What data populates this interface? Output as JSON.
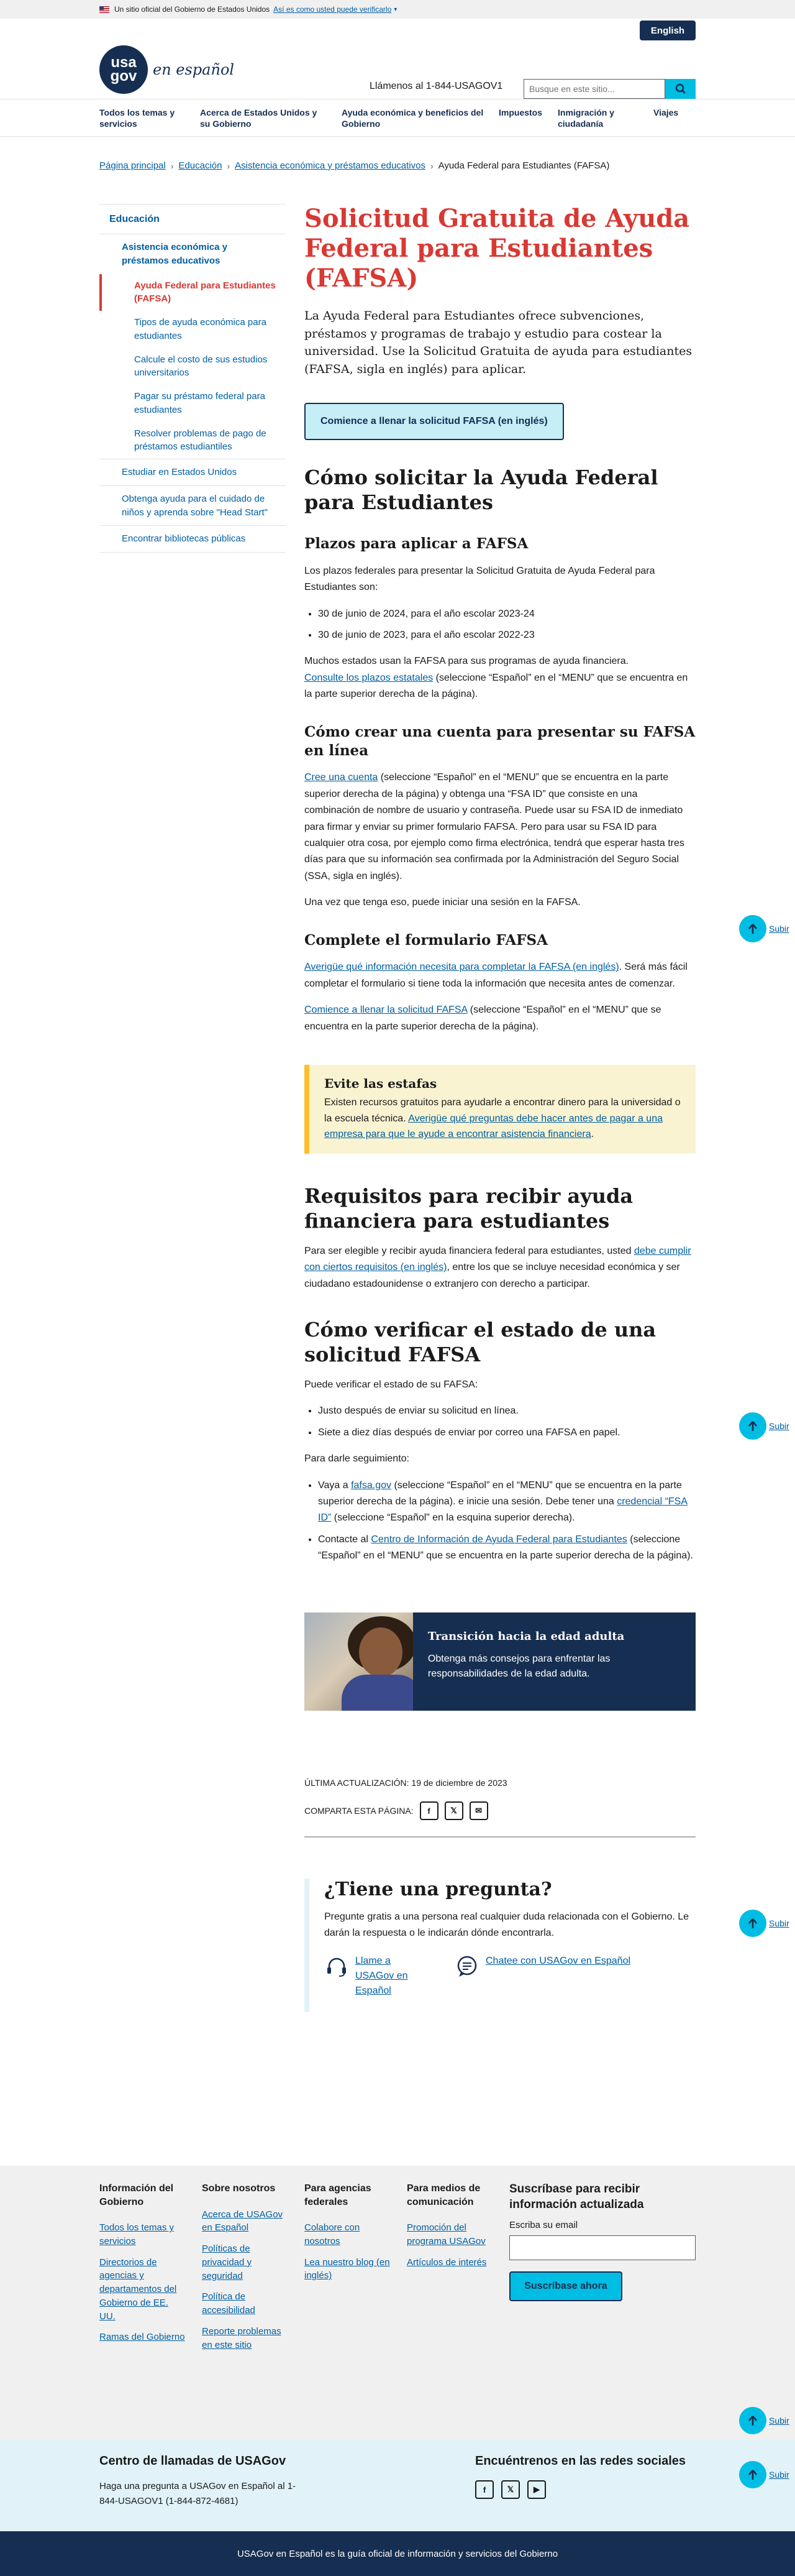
{
  "gov_banner": {
    "text": "Un sitio oficial del Gobierno de Estados Unidos",
    "how_to_verify": "Así es como usted puede verificarlo"
  },
  "header": {
    "language_button": "English",
    "logo_top": "usa",
    "logo_bottom": "gov",
    "logo_text": "en español",
    "phone": "Llámenos al 1-844-USAGOV1",
    "search_placeholder": "Busque en este sitio..."
  },
  "nav": {
    "items": [
      "Todos los temas y servicios",
      "Acerca de Estados Unidos y su Gobierno",
      "Ayuda económica y beneficios del Gobierno",
      "Impuestos",
      "Inmigración y ciudadanía",
      "Viajes"
    ]
  },
  "breadcrumb": {
    "items": [
      "Página principal",
      "Educación",
      "Asistencia económica y préstamos educativos"
    ],
    "current": "Ayuda Federal para Estudiantes (FAFSA)"
  },
  "sidebar": {
    "level1": "Educación",
    "level2": "Asistencia económica y préstamos educativos",
    "current": "Ayuda Federal para Estudiantes (FAFSA)",
    "subitems": [
      "Tipos de ayuda económica para estudiantes",
      "Calcule el costo de sus estudios universitarios",
      "Pagar su préstamo federal para estudiantes",
      "Resolver problemas de pago de préstamos estudiantiles"
    ],
    "other_items": [
      "Estudiar en Estados Unidos",
      "Obtenga ayuda para el cuidado de niños y aprenda sobre \"Head Start\"",
      "Encontrar bibliotecas públicas"
    ]
  },
  "main": {
    "title": "Solicitud Gratuita de Ayuda Federal para Estudiantes (FAFSA)",
    "intro": "La Ayuda Federal para Estudiantes ofrece subvenciones, préstamos y programas de trabajo y estudio para costear la universidad. Use la Solicitud Gratuita de ayuda para estudiantes (FAFSA, sigla en inglés) para aplicar.",
    "cta": "Comience a llenar la solicitud FAFSA (en inglés)",
    "how_to_apply": {
      "heading": "Cómo solicitar la Ayuda Federal para Estudiantes",
      "deadlines_heading": "Plazos para aplicar a FAFSA",
      "deadlines_intro": "Los plazos federales para presentar la Solicitud Gratuita de Ayuda Federal para Estudiantes son:",
      "deadlines": [
        "30 de junio de 2024, para el año escolar 2023-24",
        "30 de junio de 2023, para el año escolar 2022-23"
      ],
      "states_text": "Muchos estados usan la FAFSA para sus programas de ayuda financiera.",
      "states_link": "Consulte los plazos estatales",
      "states_suffix": " (seleccione “Español” en el “MENU” que se encuentra en la parte superior derecha de la página).",
      "account_heading": "Cómo crear una cuenta para presentar su FAFSA en línea",
      "account_link": "Cree una cuenta",
      "account_text": " (seleccione “Español” en el “MENU” que se encuentra en la parte superior derecha de la página) y obtenga una “FSA ID” que consiste en una combinación de nombre de usuario y contraseña. Puede usar su FSA ID de inmediato para firmar y enviar su primer formulario FAFSA. Pero para usar su FSA ID para cualquier otra cosa, por ejemplo como firma electrónica, tendrá que esperar hasta tres días para que su información sea confirmada por la Administración del Seguro Social (SSA, sigla en inglés).",
      "account_after": "Una vez que tenga eso, puede iniciar una sesión en la FAFSA.",
      "complete_heading": "Complete el formulario FAFSA",
      "complete_link": "Averigüe qué información necesita para completar la FAFSA (en inglés)",
      "complete_text": ". Será más fácil completar el formulario si tiene toda la información que necesita antes de comenzar.",
      "complete_link2": "Comience a llenar la solicitud FAFSA",
      "complete_text2": " (seleccione “Español” en el “MENU” que se encuentra en la parte superior derecha de la página)."
    },
    "alert": {
      "heading": "Evite las estafas",
      "text": "Existen recursos gratuitos para ayudarle a encontrar dinero para la universidad o la escuela técnica. ",
      "link": "Averigüe qué preguntas debe hacer antes de pagar a una empresa para que le ayude a encontrar asistencia financiera",
      "suffix": "."
    },
    "requirements": {
      "heading": "Requisitos para recibir ayuda financiera para estudiantes",
      "text1": "Para ser elegible y recibir ayuda financiera federal para estudiantes, usted ",
      "link": "debe cumplir con ciertos requisitos (en inglés)",
      "text2": ", entre los que se incluye necesidad económica y ser ciudadano estadounidense o extranjero con derecho a participar."
    },
    "status": {
      "heading": "Cómo verificar el estado de una solicitud FAFSA",
      "intro": "Puede verificar el estado de su FAFSA:",
      "items": [
        "Justo después de enviar su solicitud en línea.",
        "Siete a diez días después de enviar por correo una FAFSA en papel."
      ],
      "follow_intro": "Para darle seguimiento:",
      "follow1_pre": "Vaya a ",
      "follow1_link": "fafsa.gov",
      "follow1_mid": " (seleccione “Español” en el “MENU” que se encuentra en la parte superior derecha de la página). e inicie una sesión. Debe tener una ",
      "follow1_link2": "credencial “FSA ID”",
      "follow1_end": " (seleccione “Español” en la esquina superior derecha).",
      "follow2_pre": "Contacte al ",
      "follow2_link": "Centro de Información de Ayuda Federal para Estudiantes",
      "follow2_end": " (seleccione “Español” en el “MENU” que se encuentra en la parte superior derecha de la página)."
    },
    "card": {
      "title": "Transición hacia la edad adulta",
      "text": "Obtenga más consejos para enfrentar las responsabilidades de la edad adulta."
    },
    "updated": "ÚLTIMA ACTUALIZACIÓN: 19 de diciembre de 2023",
    "share_label": "COMPARTA ESTA PÁGINA:",
    "share_icons": [
      "facebook-icon",
      "x-icon",
      "email-icon"
    ]
  },
  "question": {
    "heading": "¿Tiene una pregunta?",
    "text": "Pregunte gratis a una persona real cualquier duda relacionada con el Gobierno. Le darán la respuesta o le indicarán dónde encontrarla.",
    "call_link": "Llame a USAGov en Español",
    "chat_link": "Chatee con USAGov en Español"
  },
  "to_top_label": "Subir",
  "footer": {
    "columns": [
      {
        "heading": "Información del Gobierno",
        "links": [
          "Todos los temas y servicios",
          "Directorios de agencias y departamentos del Gobierno de EE. UU.",
          "Ramas del Gobierno"
        ]
      },
      {
        "heading": "Sobre nosotros",
        "links": [
          "Acerca de USAGov en Español",
          "Políticas de privacidad y seguridad",
          "Política de accesibilidad",
          "Reporte problemas en este sitio"
        ]
      },
      {
        "heading": "Para agencias federales",
        "links": [
          "Colabore con nosotros",
          "Lea nuestro blog (en inglés)"
        ]
      },
      {
        "heading": "Para medios de comunicación",
        "links": [
          "Promoción del programa USAGov",
          "Artículos de interés"
        ]
      }
    ],
    "subscribe_heading": "Suscríbase para recibir información actualizada",
    "email_label": "Escriba su email",
    "subscribe_button": "Suscríbase ahora",
    "call_center_heading": "Centro de llamadas de USAGov",
    "call_center_text": "Haga una pregunta a USAGov en Español al 1-844-USAGOV1 (1-844-872-4681)",
    "social_heading": "Encuéntrenos en las redes sociales",
    "social_icons": [
      "facebook-icon",
      "x-icon",
      "youtube-icon"
    ],
    "bottom_text": "USAGov en Español es la guía oficial de información y servicios del Gobierno"
  },
  "colors": {
    "title_red": "#d83933",
    "navy": "#162e51",
    "link_blue": "#005ea2",
    "cyan": "#00bde3"
  }
}
